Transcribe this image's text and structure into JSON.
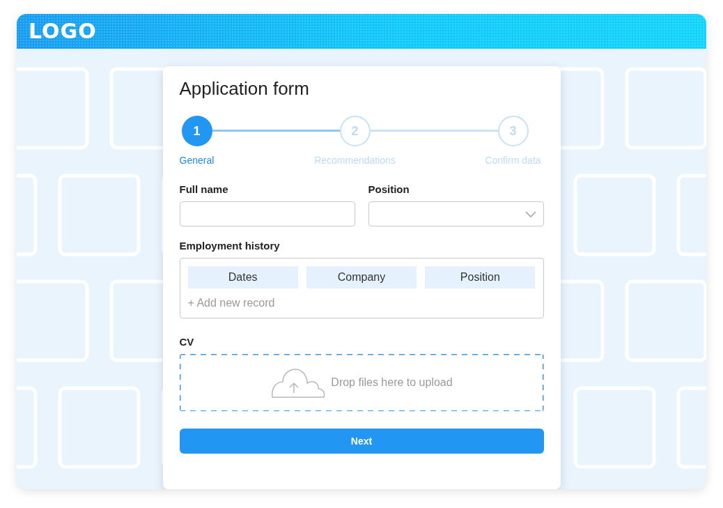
{
  "header": {
    "logo": "LOGO"
  },
  "form": {
    "title": "Application form",
    "steps": [
      {
        "number": "1",
        "label": "General",
        "selected": true
      },
      {
        "number": "2",
        "label": "Recommendations",
        "selected": false
      },
      {
        "number": "3",
        "label": "Confirm data",
        "selected": false
      }
    ],
    "fields": [
      {
        "label": "Full name",
        "kind": "text"
      },
      {
        "label": "Position",
        "kind": "select"
      }
    ],
    "employment": {
      "label": "Employment history",
      "columns": [
        "Dates",
        "Company",
        "Position"
      ],
      "add_link": "+ Add new record"
    },
    "cv": {
      "label": "CV",
      "dropzone": "Drop files here to upload"
    },
    "next_button": "Next"
  }
}
